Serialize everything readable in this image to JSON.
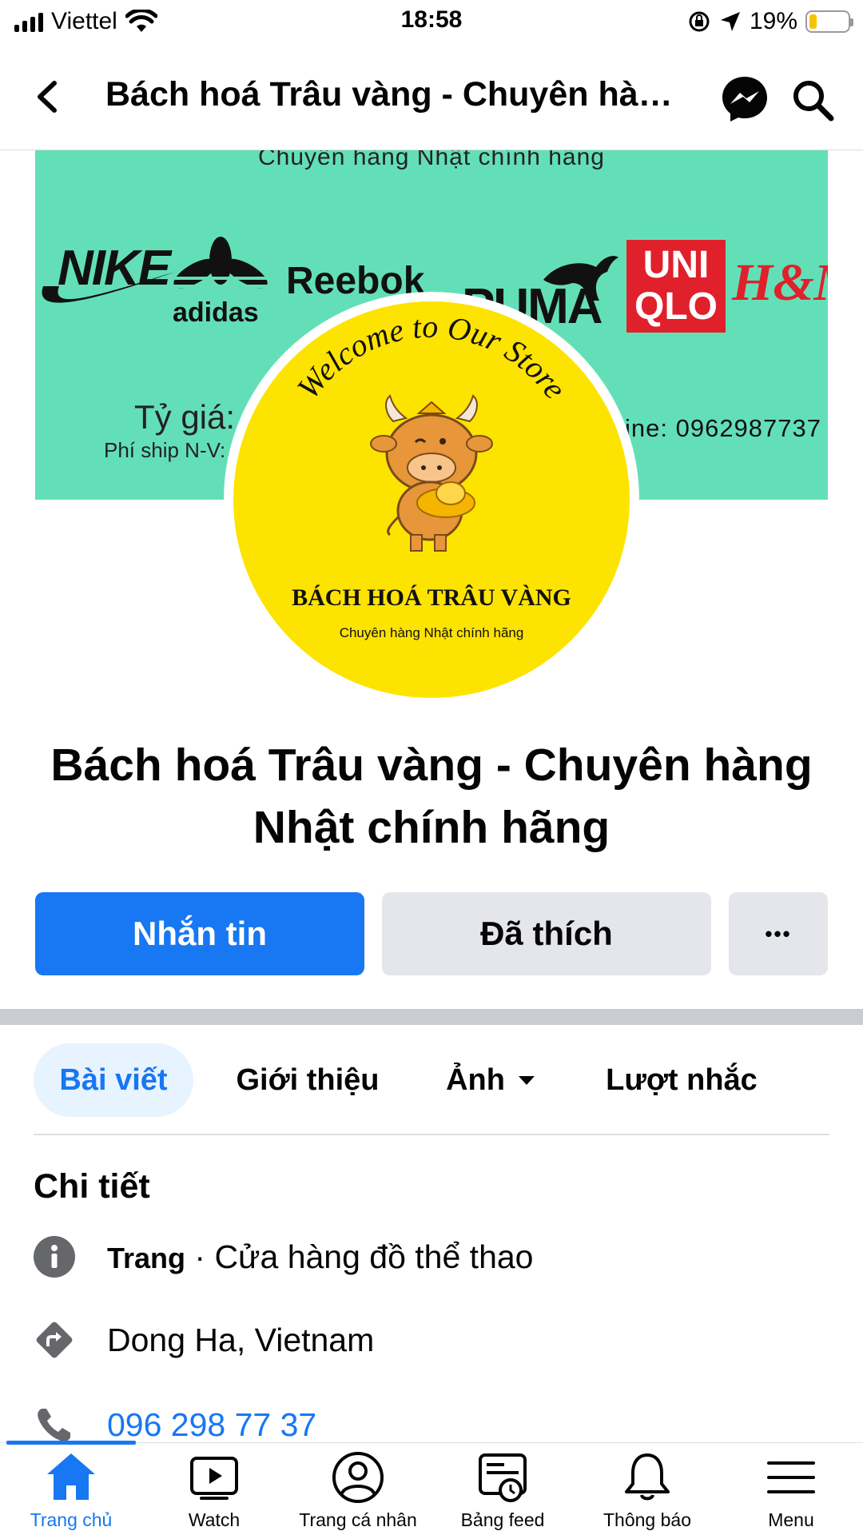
{
  "status_bar": {
    "carrier": "Viettel",
    "time": "18:58",
    "battery_percent": "19%",
    "battery_level": 0.19,
    "icons": [
      "signal-icon",
      "wifi-icon",
      "orientation-lock-icon",
      "location-arrow-icon",
      "battery-icon"
    ]
  },
  "header": {
    "title": "Bách hoá Trâu vàng - Chuyên hàng Nhật chính hãng",
    "back_icon": "chevron-left-icon",
    "messenger_icon": "messenger-icon",
    "search_icon": "search-icon"
  },
  "cover": {
    "tagline": "Chuyên hàng Nhật chính hãng",
    "brands": [
      "NIKE",
      "adidas",
      "Reebok",
      "PUMA",
      "UNI",
      "QLO",
      "H&M"
    ],
    "rate_text": "Tỷ giá: 2",
    "ship_text": "Phí ship N-V:",
    "hotline_text": "ine: 0962987737",
    "background": "#63dfb8"
  },
  "avatar": {
    "arc_text": "Welcome to Our Store",
    "store_name": "BÁCH HOÁ TRÂU VÀNG",
    "store_tagline": "Chuyên hàng Nhật chính hãng",
    "background": "#fde300"
  },
  "page_name_line1": "Bách hoá Trâu vàng - Chuyên hàng",
  "page_name_line2": "Nhật chính hãng",
  "actions": {
    "message_label": "Nhắn tin",
    "liked_label": "Đã thích",
    "more_label": "•••"
  },
  "tabs": [
    {
      "label": "Bài viết",
      "active": true
    },
    {
      "label": "Giới thiệu",
      "active": false
    },
    {
      "label": "Ảnh",
      "active": false
    },
    {
      "label": "Lượt nhắc",
      "active": false
    }
  ],
  "details": {
    "heading": "Chi tiết",
    "page_type_bold": "Trang",
    "page_type_rest": " · Cửa hàng đồ thể thao",
    "location": "Dong Ha, Vietnam",
    "phone": "096 298 77 37"
  },
  "bottom_nav": [
    {
      "label": "Trang chủ",
      "icon": "home-icon",
      "active": true
    },
    {
      "label": "Watch",
      "icon": "watch-video-icon",
      "active": false
    },
    {
      "label": "Trang cá nhân",
      "icon": "profile-icon",
      "active": false
    },
    {
      "label": "Bảng feed",
      "icon": "feed-icon",
      "active": false
    },
    {
      "label": "Thông báo",
      "icon": "bell-icon",
      "active": false
    },
    {
      "label": "Menu",
      "icon": "hamburger-menu-icon",
      "active": false
    }
  ],
  "colors": {
    "accent": "#1877f2",
    "button_gray": "#e4e6eb",
    "tab_active_bg": "#e7f3ff"
  }
}
